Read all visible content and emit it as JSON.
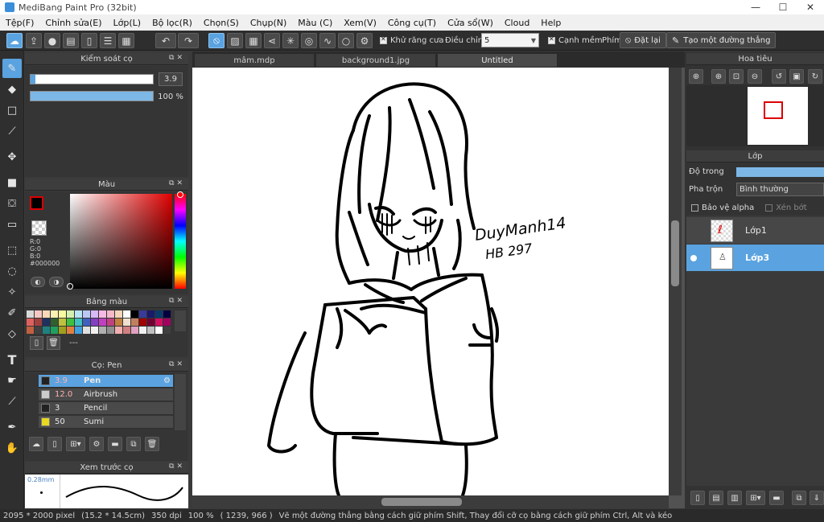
{
  "window": {
    "title": "MediBang Paint Pro (32bit)",
    "minimize": "—",
    "maximize": "☐",
    "close": "✕"
  },
  "menu": [
    "Tệp(F)",
    "Chỉnh sửa(E)",
    "Lớp(L)",
    "Bộ lọc(R)",
    "Chọn(S)",
    "Chụp(N)",
    "Màu (C)",
    "Xem(V)",
    "Công cụ(T)",
    "Cửa sổ(W)",
    "Cloud",
    "Help"
  ],
  "toolbar": {
    "antialias_label": "Khử răng cưa",
    "adjust_label": "Điều chỉnh",
    "adjust_value": "5",
    "smooth_label": "Cạnh mềm",
    "key_label": "Phím",
    "reset_label": "Đặt lại",
    "straight_line_label": "Tạo một đường thẳng"
  },
  "brush_control": {
    "title": "Kiểm soát cọ",
    "size_value": "3.9",
    "opacity_value": "100 %",
    "size_fraction": 0.04,
    "opacity_fraction": 1.0
  },
  "color_panel": {
    "title": "Màu",
    "r": "R:0",
    "g": "G:0",
    "b": "B:0",
    "hex": "#000000",
    "current_color": "#000000"
  },
  "palette_panel": {
    "title": "Bảng màu",
    "name": "---"
  },
  "brush_panel": {
    "title": "Cọ: Pen",
    "items": [
      {
        "size": "3.9",
        "name": "Pen",
        "color": "#222222",
        "selected": true
      },
      {
        "size": "12.0",
        "name": "Airbrush",
        "color": "#cccccc",
        "selected": false
      },
      {
        "size": "3",
        "name": "Pencil",
        "color": "#222222",
        "selected": false
      },
      {
        "size": "50",
        "name": "Sumi",
        "color": "#e8d820",
        "selected": false
      }
    ]
  },
  "brush_preview": {
    "title": "Xem trước cọ",
    "size_label": "0.28mm"
  },
  "tabs": [
    {
      "label": "mâm.mdp",
      "active": false
    },
    {
      "label": "background1.jpg",
      "active": false
    },
    {
      "label": "Untitled",
      "active": true
    }
  ],
  "canvas": {
    "signature_line1": "DuyManh14",
    "signature_line2": "HB 297"
  },
  "navigator": {
    "title": "Hoa tiêu"
  },
  "layers_panel": {
    "title": "Lớp",
    "opacity_label": "Độ trong",
    "blend_label": "Pha trộn",
    "blend_value": "Bình thường",
    "protect_alpha_label": "Bảo vệ alpha",
    "clipping_label": "Xén bớt",
    "layers": [
      {
        "name": "Lớp1",
        "selected": false,
        "visible": false
      },
      {
        "name": "Lớp3",
        "selected": true,
        "visible": true
      }
    ]
  },
  "status": {
    "pixels": "2095 * 2000 pixel",
    "cm": "(15.2 * 14.5cm)",
    "dpi": "350 dpi",
    "zoom": "100 %",
    "coords": "( 1239, 966 )",
    "hint": "Vẽ một đường thẳng bằng cách giữ phím Shift, Thay đổi cỡ cọ bằng cách giữ phím Ctrl, Alt và kéo"
  },
  "colors": {
    "accent": "#5aa3e0",
    "panel_bg": "#353535",
    "selected_layer": "#5aa3e0"
  }
}
